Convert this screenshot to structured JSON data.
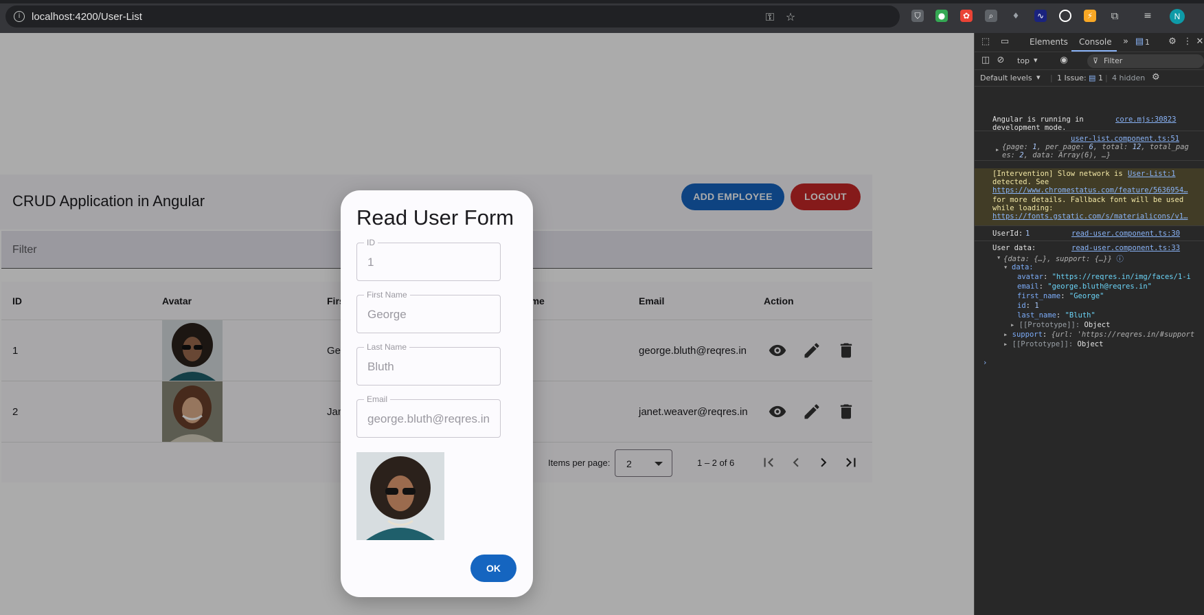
{
  "browser": {
    "url": "localhost:4200/User-List",
    "profile_initial": "N"
  },
  "app": {
    "title": "CRUD Application in Angular",
    "add_button": "ADD EMPLOYEE",
    "logout_button": "LOGOUT",
    "filter_placeholder": "Filter",
    "table": {
      "headers": [
        "ID",
        "Avatar",
        "First Name",
        "Last Name",
        "Email",
        "Action"
      ],
      "rows": [
        {
          "id": "1",
          "first_name": "George",
          "email": "george.bluth@reqres.in"
        },
        {
          "id": "2",
          "first_name": "Janet",
          "email": "janet.weaver@reqres.in"
        }
      ]
    },
    "paginator": {
      "items_per_page_label": "Items per page:",
      "page_size": "2",
      "range": "1 – 2 of 6"
    },
    "colors": {
      "primary": "#1565c0",
      "danger": "#c62828"
    }
  },
  "dialog": {
    "title": "Read User Form",
    "fields": [
      {
        "label": "ID",
        "value": "1"
      },
      {
        "label": "First Name",
        "value": "George"
      },
      {
        "label": "Last Name",
        "value": "Bluth"
      },
      {
        "label": "Email",
        "value": "george.bluth@reqres.in"
      }
    ],
    "ok_button": "OK"
  },
  "devtools": {
    "tabs": {
      "elements": "Elements",
      "console": "Console",
      "issue_badge": "1"
    },
    "context": "top",
    "filter": "Filter",
    "levels": "Default levels",
    "issues": "1 Issue:",
    "issues_count": "1",
    "hidden": "4 hidden",
    "logs": {
      "angular_msg_1": "Angular is running in",
      "angular_msg_2": "development mode.",
      "angular_src": "core.mjs:30823",
      "list_src": "user-list.component.ts:51",
      "intervention_1": "[Intervention] Slow network is",
      "intervention_2": "detected. See",
      "intervention_link1": "https://www.chromestatus.com/feature/5636954…",
      "intervention_3": "for more details. Fallback font will be used",
      "intervention_4": "while loading:",
      "intervention_link2": "https://fonts.gstatic.com/s/materialicons/v1…",
      "intervention_src": "User-List:1",
      "userid_label": "UserId:",
      "userid_value": "1",
      "userid_src": "read-user.component.ts:30",
      "userdata_label": "User data:",
      "userdata_src": "read-user.component.ts:33",
      "data_key": "data:",
      "avatar_value": "\"https://reqres.in/img/faces/1-i",
      "email_value": "\"george.bluth@reqres.in\"",
      "first_name_value": "\"George\"",
      "id_value": "1",
      "last_name_value": "\"Bluth\"",
      "proto": "[[Prototype]]:",
      "object": "Object",
      "support_value": "{url: 'https://reqres.in/#support"
    }
  }
}
